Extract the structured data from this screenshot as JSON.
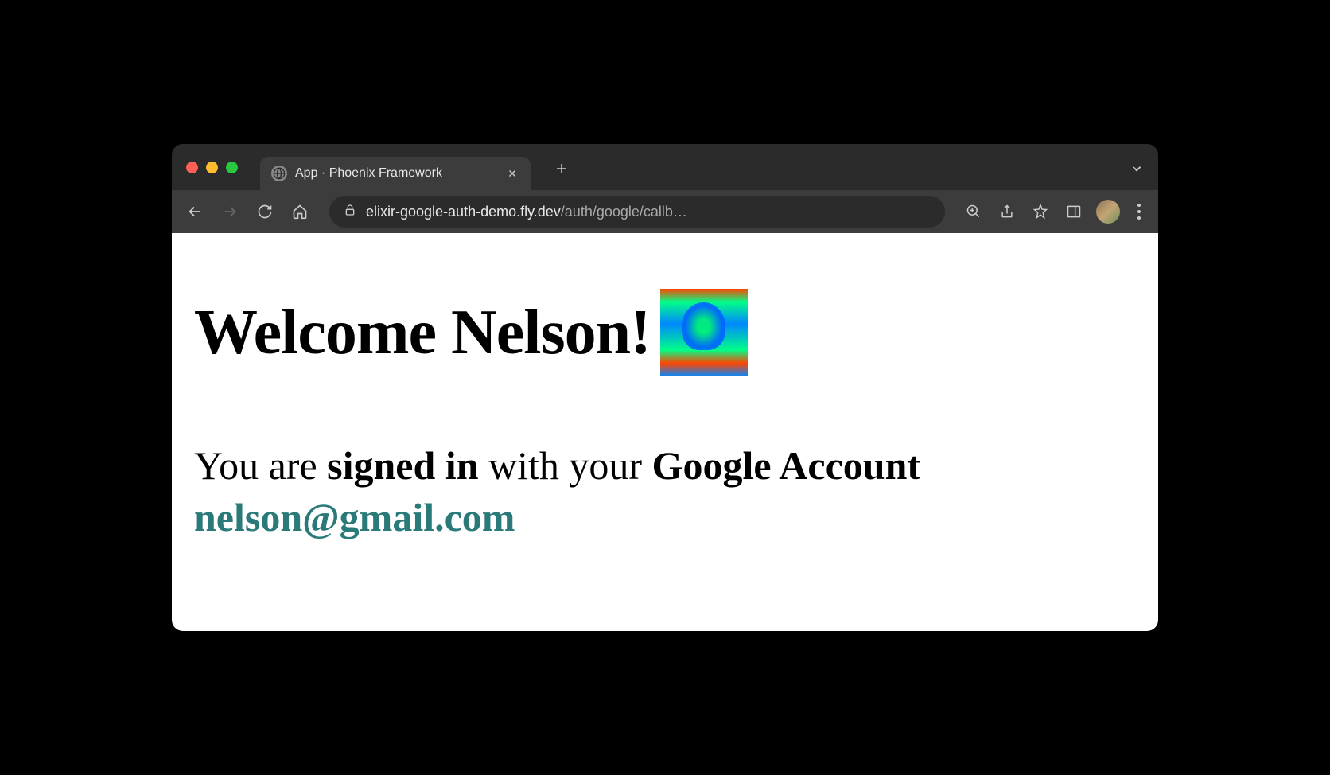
{
  "browser": {
    "tab": {
      "title": "App · Phoenix Framework"
    },
    "url": {
      "host": "elixir-google-auth-demo.fly.dev",
      "path": "/auth/google/callb…"
    }
  },
  "page": {
    "welcome_prefix": "Welcome ",
    "user_name": "Nelson",
    "welcome_suffix": "!",
    "status": {
      "p1": "You are ",
      "p2_bold": "signed in",
      "p3": " with your ",
      "p4_bold": "Google Account"
    },
    "email": "nelson@gmail.com"
  }
}
